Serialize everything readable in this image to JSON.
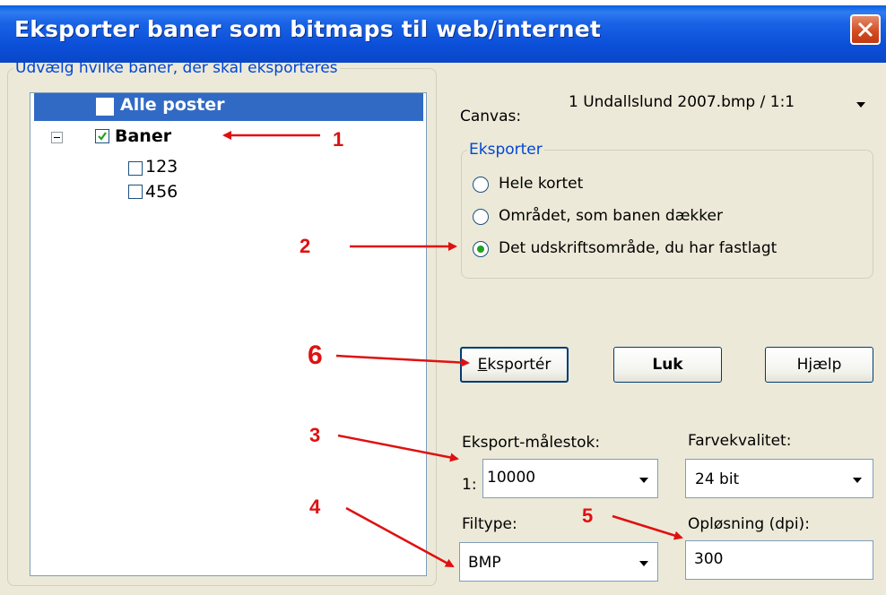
{
  "window": {
    "title": "Eksporter baner som bitmaps til web/internet",
    "close_icon": "close-icon"
  },
  "course_group": {
    "legend": "Udvælg hvilke baner, der skal eksporteres",
    "items": [
      {
        "label": "Alle poster",
        "checked": false,
        "selected": true
      },
      {
        "label": "Baner",
        "checked": true,
        "bold": true,
        "expanded": true
      },
      {
        "label": "123",
        "checked": false
      },
      {
        "label": "456",
        "checked": false
      }
    ]
  },
  "canvas": {
    "label": "Canvas:",
    "value": "1 Undallslund 2007.bmp  / 1:1"
  },
  "export_group": {
    "legend": "Eksporter",
    "options": [
      {
        "label": "Hele kortet",
        "selected": false
      },
      {
        "label": "Området, som banen dækker",
        "selected": false
      },
      {
        "label": "Det udskriftsområde, du har fastlagt",
        "selected": true
      }
    ]
  },
  "buttons": {
    "export_rest": "ksportér",
    "export_mnemonic": "E",
    "close": "Luk",
    "help": "Hjælp"
  },
  "scale": {
    "label": "Eksport-målestok:",
    "prefix": "1:",
    "value": "10000"
  },
  "color": {
    "label": "Farvekvalitet:",
    "value": "24 bit"
  },
  "filetype": {
    "label": "Filtype:",
    "value": "BMP"
  },
  "resolution": {
    "label": "Opløsning (dpi):",
    "value": "300"
  },
  "annotations": [
    "1",
    "2",
    "3",
    "4",
    "5",
    "6"
  ],
  "colors": {
    "accent": "#0a47c8",
    "annotation": "#e01010",
    "selection": "#316ac5",
    "dialog_bg": "#ece9d8"
  }
}
